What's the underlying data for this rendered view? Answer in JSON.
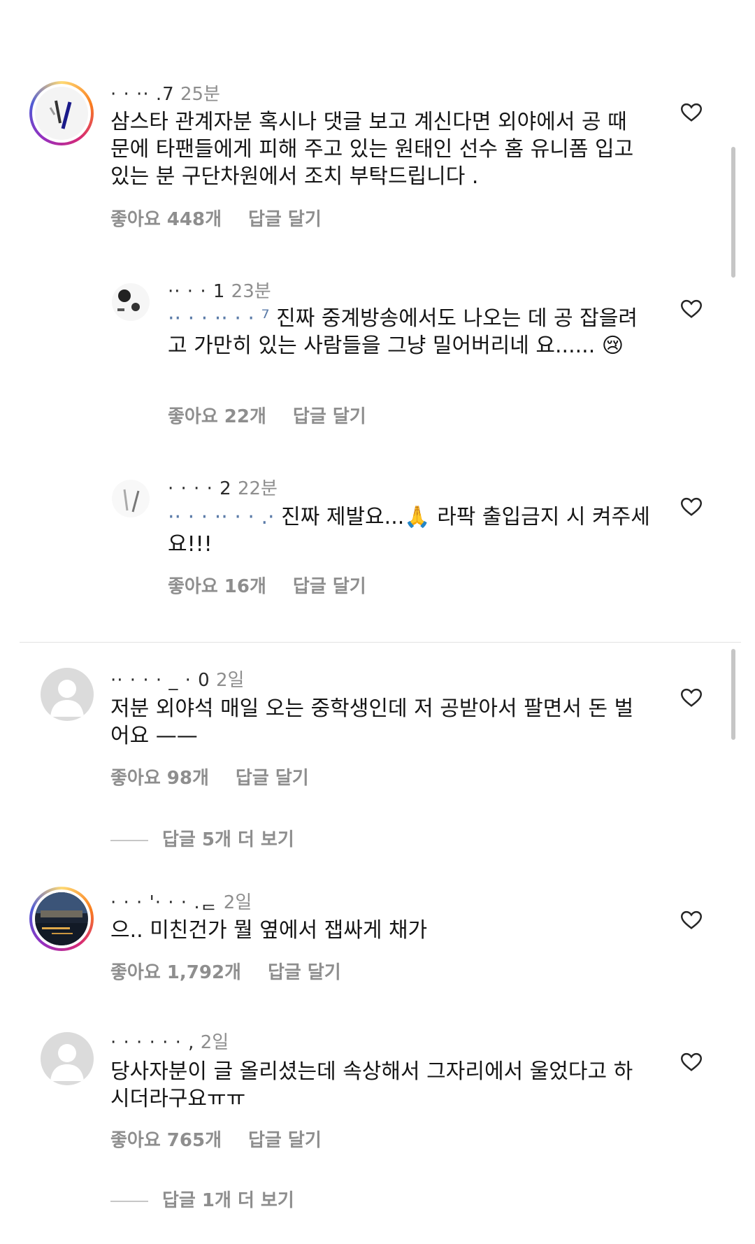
{
  "comments": [
    {
      "username": "·  ·  ··  .7",
      "time": "25분",
      "text": "삼스타 관계자분 혹시나 댓글 보고 계신다면 외야에서 공 때문에 타팬들에게 피해 주고 있는 원태인 선수 홈 유니폼 입고 있는 분 구단차원에서 조치 부탁드립니다 .",
      "likes": "좋아요 448개",
      "reply": "답글 달기"
    },
    {
      "username": "··  ·  ·   1",
      "time": "23분",
      "mention": "··  ·  ·  ··  ·  ·   ⁷",
      "text": "진짜 중계방송에서도 나오는 데 공 잡을려고 가만히 있는 사람들을 그냥 밀어버리네 요......",
      "emoji": "😢",
      "likes": "좋아요 22개",
      "reply": "답글 달기"
    },
    {
      "username": "·   ·   ·  ·  2",
      "time": "22분",
      "mention": "··  ·  ·  ··  ·  ·  .·",
      "text_before": "진짜 제발요...",
      "emoji": "🙏",
      "text_after": "라팍 출입금지 시 켜주세요!!!",
      "likes": "좋아요 16개",
      "reply": "답글 달기"
    },
    {
      "username": "··  ·  ·  ·  _  ·  0",
      "time": "2일",
      "text": "저분 외야석 매일 오는 중학생인데 저 공받아서 팔면서 돈 벌어요 ——",
      "likes": "좋아요 98개",
      "reply": "답글 달기",
      "view_more": "답글 5개 더 보기"
    },
    {
      "username": "·  ·   ·  '·  ·  ·  .ᆮ",
      "time": "2일",
      "text": "으.. 미친건가 뭘 옆에서 잽싸게 채가",
      "likes": "좋아요 1,792개",
      "reply": "답글 달기"
    },
    {
      "username": "·  ·   ·  ·  ·  ·  ,",
      "time": "2일",
      "text": "당사자분이 글 올리셨는데 속상해서 그자리에서 울었다고 하시더라구요ㅠㅠ",
      "likes": "좋아요 765개",
      "reply": "답글 달기",
      "view_more": "답글 1개 더 보기"
    }
  ]
}
